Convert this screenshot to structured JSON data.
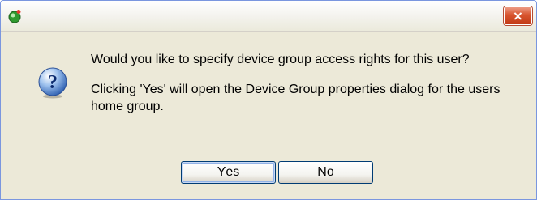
{
  "titlebar": {
    "app_icon": "green-app-icon",
    "close_icon": "close-x-icon",
    "close_label": "×"
  },
  "dialog": {
    "icon": "question-mark-icon",
    "icon_glyph": "?",
    "message_line1": "Would you like to specify device group access rights for this user?",
    "message_line2": "Clicking 'Yes' will open the Device Group properties dialog for the users home group."
  },
  "buttons": {
    "yes": {
      "accel": "Y",
      "rest": "es"
    },
    "no": {
      "accel": "N",
      "rest": "o"
    }
  }
}
